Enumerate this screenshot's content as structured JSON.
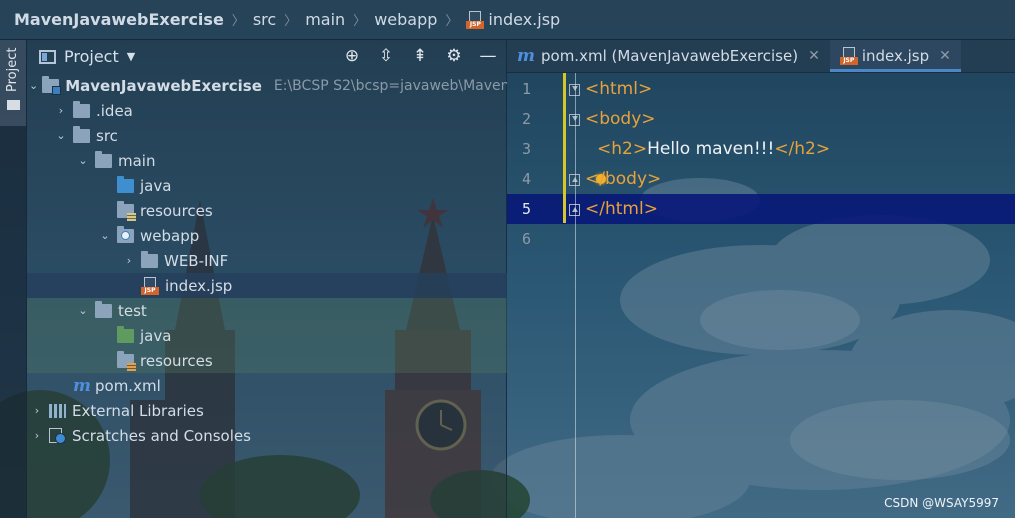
{
  "breadcrumb": {
    "items": [
      "MavenJavawebExercise",
      "src",
      "main",
      "webapp",
      "index.jsp"
    ]
  },
  "toolstrip": {
    "project_tab_label": "Project"
  },
  "project_panel": {
    "title": "Project",
    "actions": [
      "crosshair-icon",
      "expand-all-icon",
      "collapse-all-icon",
      "gear-icon",
      "minimize-icon"
    ],
    "tree": [
      {
        "label": "MavenJavawebExercise",
        "path": "E:\\BCSP  S2\\bcsp=javaweb\\Maven"
      },
      {
        "label": ".idea"
      },
      {
        "label": "src"
      },
      {
        "label": "main"
      },
      {
        "label": "java"
      },
      {
        "label": "resources"
      },
      {
        "label": "webapp"
      },
      {
        "label": "WEB-INF"
      },
      {
        "label": "index.jsp"
      },
      {
        "label": "test"
      },
      {
        "label": "java"
      },
      {
        "label": "resources"
      },
      {
        "label": "pom.xml"
      },
      {
        "label": "External Libraries"
      },
      {
        "label": "Scratches and Consoles"
      }
    ]
  },
  "editor": {
    "tabs": [
      {
        "label": "pom.xml (MavenJavawebExercise)",
        "icon": "maven-icon",
        "active": false
      },
      {
        "label": "index.jsp",
        "icon": "jsp-icon",
        "active": true
      }
    ],
    "lines": [
      {
        "num": "1",
        "parts": [
          {
            "t": "<html>",
            "k": "tag"
          }
        ]
      },
      {
        "num": "2",
        "parts": [
          {
            "t": "<body>",
            "k": "tag"
          }
        ]
      },
      {
        "num": "3",
        "parts": [
          {
            "t": "<h2>",
            "k": "tag"
          },
          {
            "t": "Hello maven!!!",
            "k": "txt"
          },
          {
            "t": "</h2>",
            "k": "tag"
          }
        ]
      },
      {
        "num": "4",
        "parts": [
          {
            "t": "</body>",
            "k": "tag"
          }
        ]
      },
      {
        "num": "5",
        "parts": [
          {
            "t": "</html>",
            "k": "tag"
          }
        ]
      },
      {
        "num": "6",
        "parts": []
      }
    ],
    "current_line": "5"
  },
  "colors": {
    "tag": "#e8a23b",
    "text": "#eef2f6",
    "current_line": "#081878",
    "accent": "#4a88c7"
  },
  "watermark": "CSDN @WSAY5997"
}
